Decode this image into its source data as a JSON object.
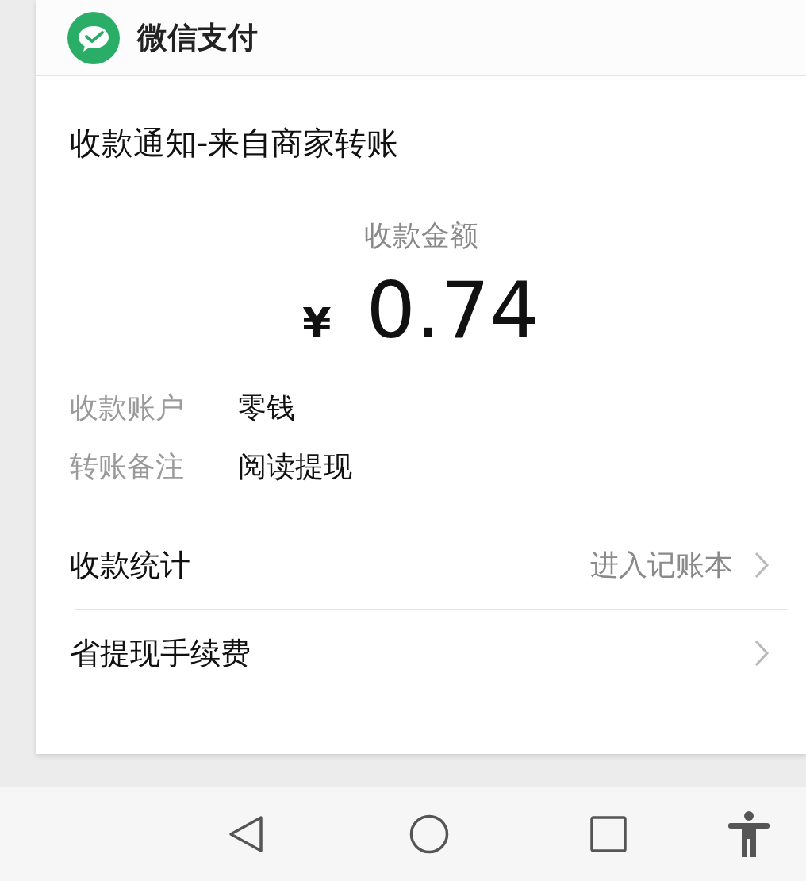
{
  "header": {
    "app_name": "微信支付"
  },
  "notice": {
    "title": "收款通知-来自商家转账",
    "amount_label": "收款金额",
    "currency": "¥",
    "amount": "0.74",
    "details": [
      {
        "label": "收款账户",
        "value": "零钱"
      },
      {
        "label": "转账备注",
        "value": "阅读提现"
      }
    ]
  },
  "links": [
    {
      "label": "收款统计",
      "action": "进入记账本"
    },
    {
      "label": "省提现手续费"
    }
  ]
}
